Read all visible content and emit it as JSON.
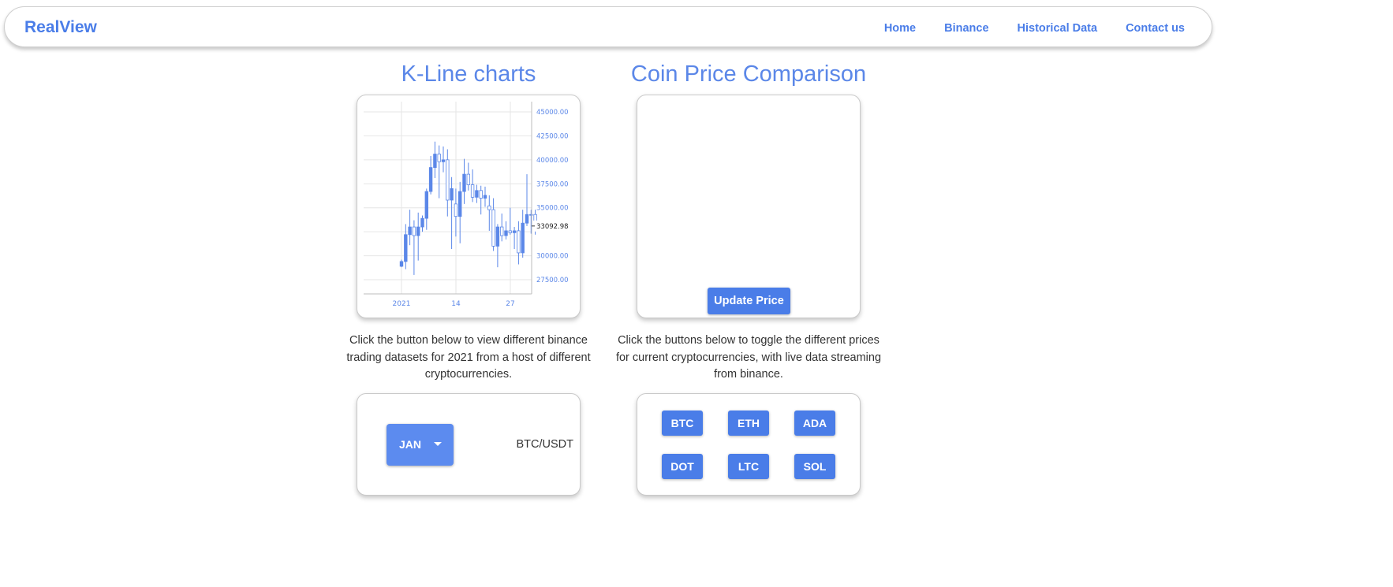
{
  "nav": {
    "brand": "RealView",
    "links": [
      "Home",
      "Binance",
      "Historical Data",
      "Contact us"
    ]
  },
  "kline": {
    "title": "K-Line charts",
    "description": "Click the button below to view different binance trading datasets for 2021 from a host of different cryptocurrencies.",
    "month_select": "JAN",
    "pair": "BTC/USDT"
  },
  "comparison": {
    "title": "Coin Price Comparison",
    "update_button": "Update Price",
    "description": "Click the buttons below to toggle the different prices for current cryptocurrencies, with live data streaming from binance.",
    "coins": [
      "BTC",
      "ETH",
      "ADA",
      "DOT",
      "LTC",
      "SOL"
    ]
  },
  "colors": {
    "accent": "#4a7de8",
    "candle": "#5b87e8",
    "grid": "#e6e6e6"
  },
  "chart_data": {
    "type": "candlestick",
    "x_ticks": [
      "2021",
      "14",
      "27"
    ],
    "y_ticks": [
      "45000.00",
      "42500.00",
      "40000.00",
      "37500.00",
      "35000.00",
      "30000.00",
      "27500.00"
    ],
    "last_price_label": "33092.98",
    "ylim": [
      26000,
      46000
    ],
    "candles": [
      {
        "o": 28900,
        "h": 29600,
        "l": 28800,
        "c": 29400
      },
      {
        "o": 29400,
        "h": 33300,
        "l": 28600,
        "c": 32200
      },
      {
        "o": 32200,
        "h": 34800,
        "l": 31100,
        "c": 33000
      },
      {
        "o": 33000,
        "h": 33700,
        "l": 28000,
        "c": 32100
      },
      {
        "o": 32100,
        "h": 34500,
        "l": 29500,
        "c": 33000
      },
      {
        "o": 33000,
        "h": 34200,
        "l": 32500,
        "c": 33900
      },
      {
        "o": 33900,
        "h": 37000,
        "l": 32700,
        "c": 36700
      },
      {
        "o": 36700,
        "h": 40400,
        "l": 36400,
        "c": 39200
      },
      {
        "o": 39200,
        "h": 41900,
        "l": 38100,
        "c": 40600
      },
      {
        "o": 40600,
        "h": 41500,
        "l": 36000,
        "c": 39800
      },
      {
        "o": 39800,
        "h": 41400,
        "l": 38700,
        "c": 40000
      },
      {
        "o": 40000,
        "h": 41100,
        "l": 34100,
        "c": 35800
      },
      {
        "o": 35800,
        "h": 38200,
        "l": 30700,
        "c": 37000
      },
      {
        "o": 35400,
        "h": 37000,
        "l": 32000,
        "c": 34100
      },
      {
        "o": 34100,
        "h": 37700,
        "l": 31300,
        "c": 36700
      },
      {
        "o": 36700,
        "h": 40100,
        "l": 35400,
        "c": 38500
      },
      {
        "o": 38500,
        "h": 39700,
        "l": 36800,
        "c": 37400
      },
      {
        "o": 37400,
        "h": 39000,
        "l": 35600,
        "c": 36100
      },
      {
        "o": 36100,
        "h": 37400,
        "l": 35500,
        "c": 36800
      },
      {
        "o": 36800,
        "h": 37300,
        "l": 34300,
        "c": 36000
      },
      {
        "o": 36000,
        "h": 37200,
        "l": 35100,
        "c": 36300
      },
      {
        "o": 35200,
        "h": 36300,
        "l": 32600,
        "c": 34800
      },
      {
        "o": 34800,
        "h": 36000,
        "l": 30500,
        "c": 31000
      },
      {
        "o": 31000,
        "h": 33300,
        "l": 28800,
        "c": 33000
      },
      {
        "o": 33000,
        "h": 34400,
        "l": 31500,
        "c": 32100
      },
      {
        "o": 32100,
        "h": 33600,
        "l": 31700,
        "c": 32600
      },
      {
        "o": 32600,
        "h": 35000,
        "l": 32200,
        "c": 32400
      },
      {
        "o": 32400,
        "h": 33000,
        "l": 30700,
        "c": 32600
      },
      {
        "o": 32600,
        "h": 33600,
        "l": 29100,
        "c": 30300
      },
      {
        "o": 30300,
        "h": 34800,
        "l": 29800,
        "c": 33400
      },
      {
        "o": 33400,
        "h": 38500,
        "l": 33100,
        "c": 34300
      },
      {
        "o": 34300,
        "h": 34800,
        "l": 32300,
        "c": 34300
      },
      {
        "o": 34300,
        "h": 34800,
        "l": 32200,
        "c": 33100
      }
    ]
  }
}
